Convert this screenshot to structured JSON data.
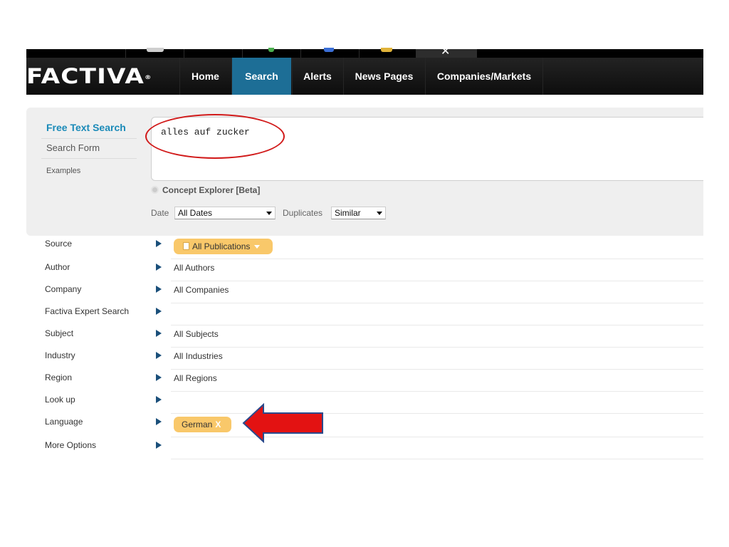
{
  "nav": {
    "logo": "FACTIVA",
    "logo_mark": "®",
    "items": [
      {
        "label": "Home"
      },
      {
        "label": "Search"
      },
      {
        "label": "Alerts"
      },
      {
        "label": "News Pages"
      },
      {
        "label": "Companies/Markets"
      }
    ],
    "active": "Search",
    "active_color": "#1d6e96"
  },
  "search": {
    "side_links": [
      "Free Text Search",
      "Search Form",
      "Examples"
    ],
    "query": "alles auf zucker",
    "concept_explorer": "Concept Explorer [Beta]",
    "date_label": "Date",
    "date_value": "All Dates",
    "duplicates_label": "Duplicates",
    "duplicates_value": "Similar"
  },
  "filters": [
    {
      "label": "Source",
      "value": "All Publications"
    },
    {
      "label": "Author",
      "value": "All Authors"
    },
    {
      "label": "Company",
      "value": "All Companies"
    },
    {
      "label": "Factiva Expert Search",
      "value": ""
    },
    {
      "label": "Subject",
      "value": "All Subjects"
    },
    {
      "label": "Industry",
      "value": "All Industries"
    },
    {
      "label": "Region",
      "value": "All Regions"
    },
    {
      "label": "Look up",
      "value": ""
    },
    {
      "label": "Language",
      "value": "German"
    },
    {
      "label": "More Options",
      "value": ""
    }
  ],
  "pill_remove_mark": "X",
  "top_strip_close": "✕",
  "colors": {
    "nav_bg": "#111111",
    "link_blue": "#1a8ab8",
    "pill_orange": "#f9c86a",
    "annotation_red": "#e31212",
    "annotation_outline": "#2b4a8c"
  }
}
